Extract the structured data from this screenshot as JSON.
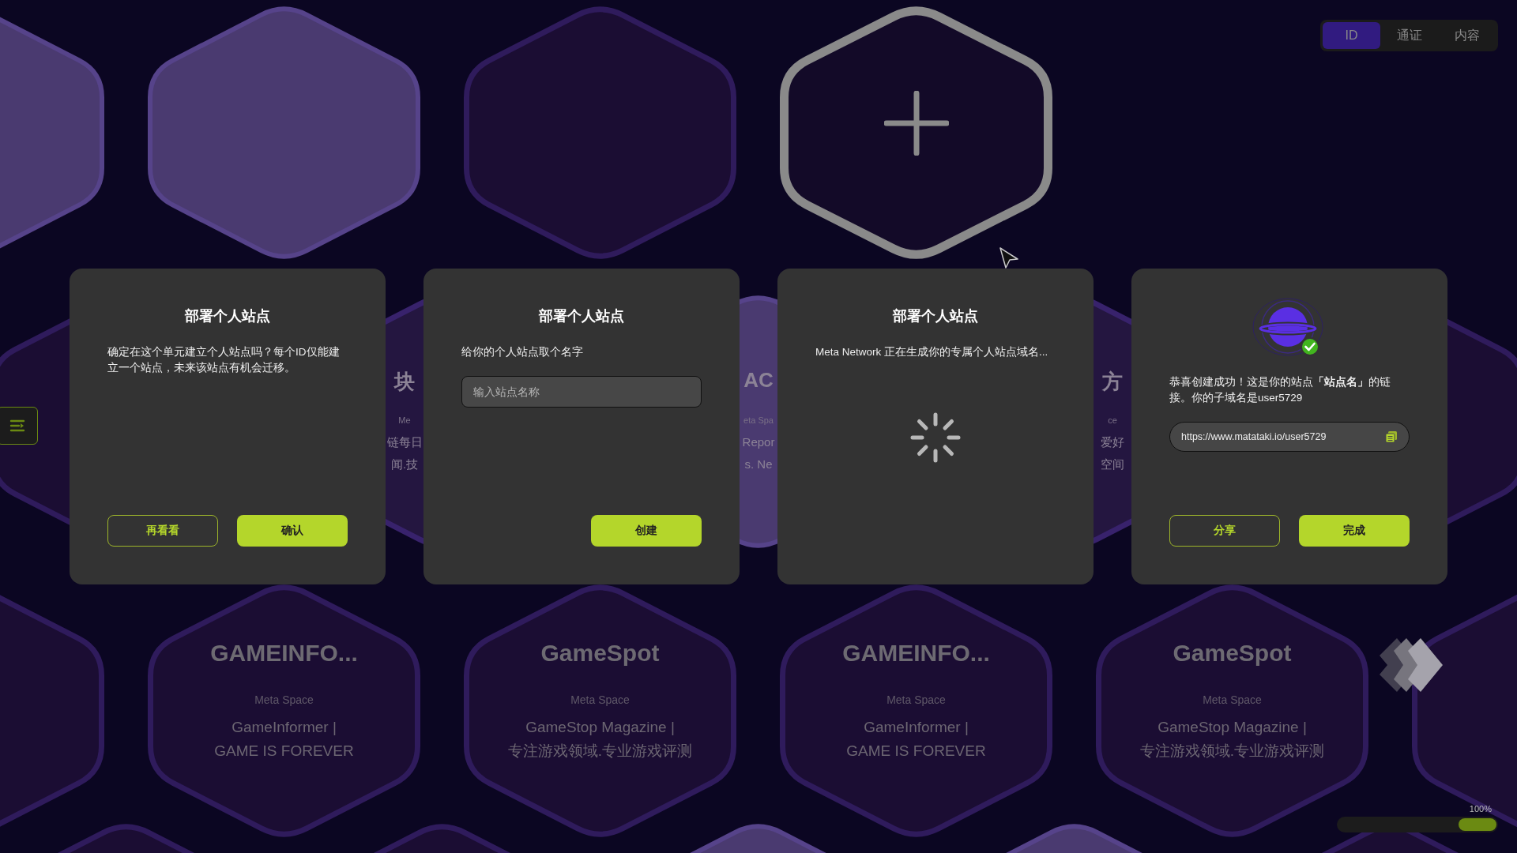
{
  "tabs": [
    {
      "label": "ID",
      "selected": true
    },
    {
      "label": "通证",
      "selected": false
    },
    {
      "label": "内容",
      "selected": false
    }
  ],
  "partly_hidden_tiles": [
    {
      "title": "块",
      "subtitle": "Me",
      "lines": [
        "链每日",
        "闻.技"
      ]
    },
    {
      "title": "AC",
      "subtitle": "eta Spa",
      "lines": [
        "Repor",
        "s. Ne"
      ]
    },
    {
      "title": "方",
      "subtitle": "ce",
      "lines": [
        "爱好",
        "空间"
      ]
    }
  ],
  "dialogs": [
    {
      "kind": "confirm",
      "title": "部署个人站点",
      "message": "确定在这个单元建立个人站点吗？每个ID仅能建立一个站点，未来该站点有机会迁移。",
      "buttons": [
        {
          "label": "再看看",
          "kind": "outline"
        },
        {
          "label": "确认",
          "kind": "primary"
        }
      ]
    },
    {
      "kind": "name",
      "title": "部署个人站点",
      "message": "给你的个人站点取个名字",
      "input": {
        "placeholder": "输入站点名称"
      },
      "buttons": [
        {
          "label": "创建",
          "kind": "primary"
        }
      ]
    },
    {
      "kind": "loading",
      "title": "部署个人站点",
      "message": "Meta Network 正在生成你的专属个人站点域名..."
    },
    {
      "kind": "success",
      "message": "恭喜创建成功！这是你的站点**「站点名」**的链接。你的子域名是user5729",
      "link": "https://www.matataki.io/user5729",
      "buttons": [
        {
          "label": "分享",
          "kind": "outline"
        },
        {
          "label": "完成",
          "kind": "primary"
        }
      ]
    }
  ],
  "bottom_tiles": [
    {
      "title": "GAMEINFO...",
      "subtitle": "Meta Space",
      "lines": [
        "GameInformer |",
        "GAME IS FOREVER"
      ]
    },
    {
      "title": "GameSpot",
      "subtitle": "Meta Space",
      "lines": [
        "GameStop Magazine |",
        "专注游戏领域.专业游戏评测"
      ]
    },
    {
      "title": "GAMEINFO...",
      "subtitle": "Meta Space",
      "lines": [
        "GameInformer |",
        "GAME IS FOREVER"
      ]
    },
    {
      "title": "GameSpot",
      "subtitle": "Meta Space",
      "lines": [
        "GameStop Magazine |",
        "专注游戏领域.专业游戏评测"
      ]
    }
  ],
  "zoom": {
    "reading": "100%",
    "level": 1
  }
}
